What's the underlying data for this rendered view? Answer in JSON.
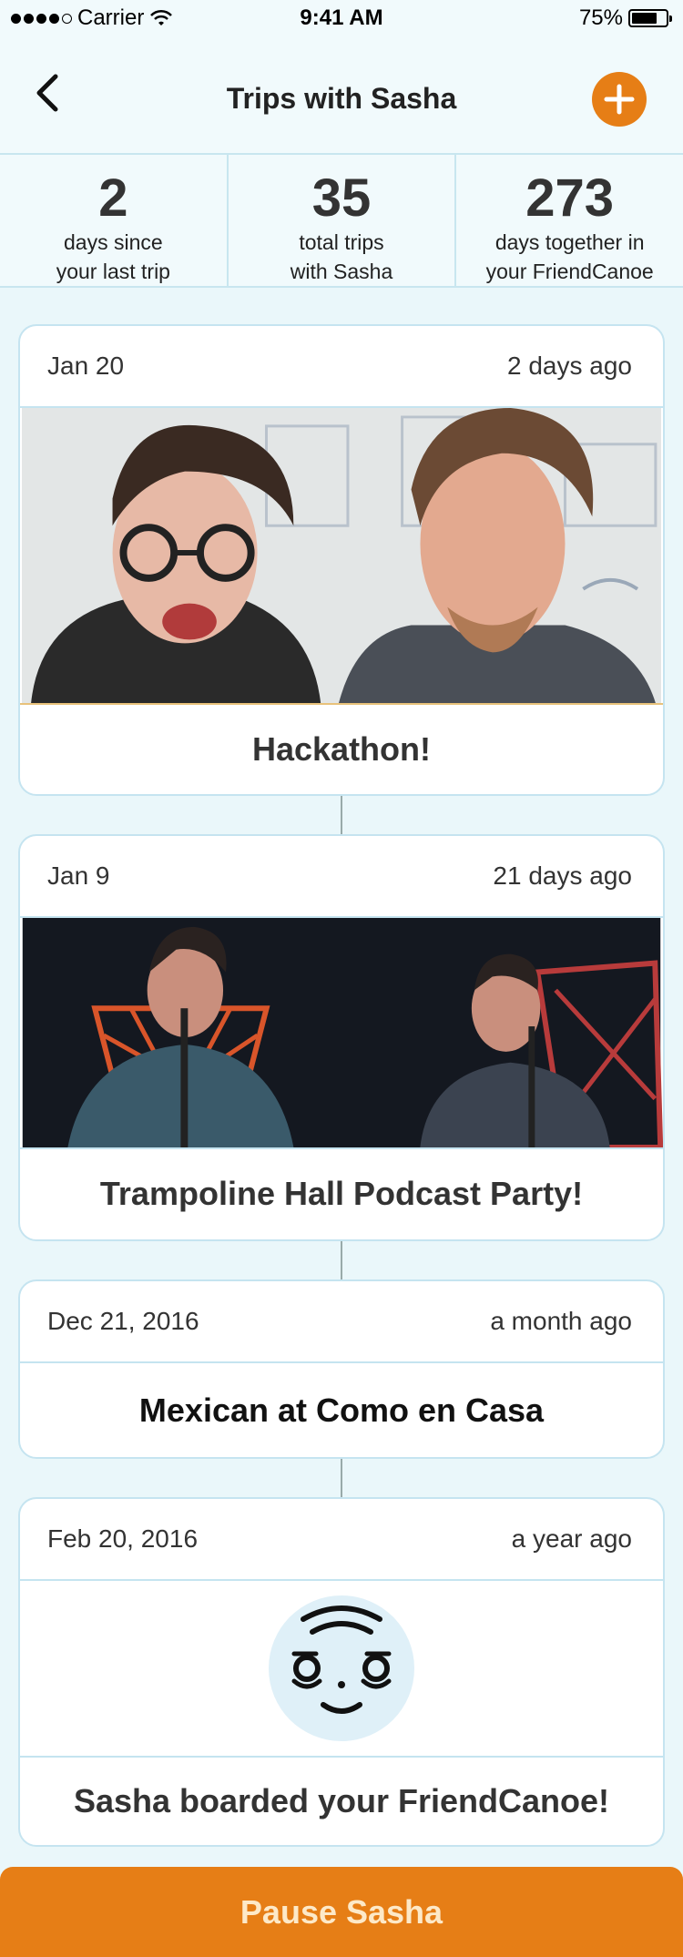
{
  "status_bar": {
    "carrier": "Carrier",
    "time": "9:41 AM",
    "battery": "75%",
    "battery_level": 0.75
  },
  "nav": {
    "title": "Trips with Sasha",
    "back_icon": "chevron-left-icon",
    "add_icon": "plus-icon"
  },
  "stats": [
    {
      "value": "2",
      "label_line1": "days since",
      "label_line2": "your last trip"
    },
    {
      "value": "35",
      "label_line1": "total trips",
      "label_line2": "with Sasha"
    },
    {
      "value": "273",
      "label_line1": "days together in",
      "label_line2": "your FriendCanoe"
    }
  ],
  "trips": [
    {
      "date": "Jan 20",
      "ago": "2 days ago",
      "title": "Hackathon!"
    },
    {
      "date": "Jan 9",
      "ago": "21 days ago",
      "title": "Trampoline Hall Podcast Party!"
    },
    {
      "date": "Dec 21, 2016",
      "ago": "a month ago",
      "title": "Mexican at Como en Casa"
    },
    {
      "date": "Feb 20, 2016",
      "ago": "a year ago",
      "title": "Sasha boarded your FriendCanoe!"
    }
  ],
  "pause_button": {
    "label": "Pause Sasha"
  },
  "colors": {
    "accent": "#e67e16",
    "background": "#eaf7fa",
    "border": "#c5e4f0"
  }
}
